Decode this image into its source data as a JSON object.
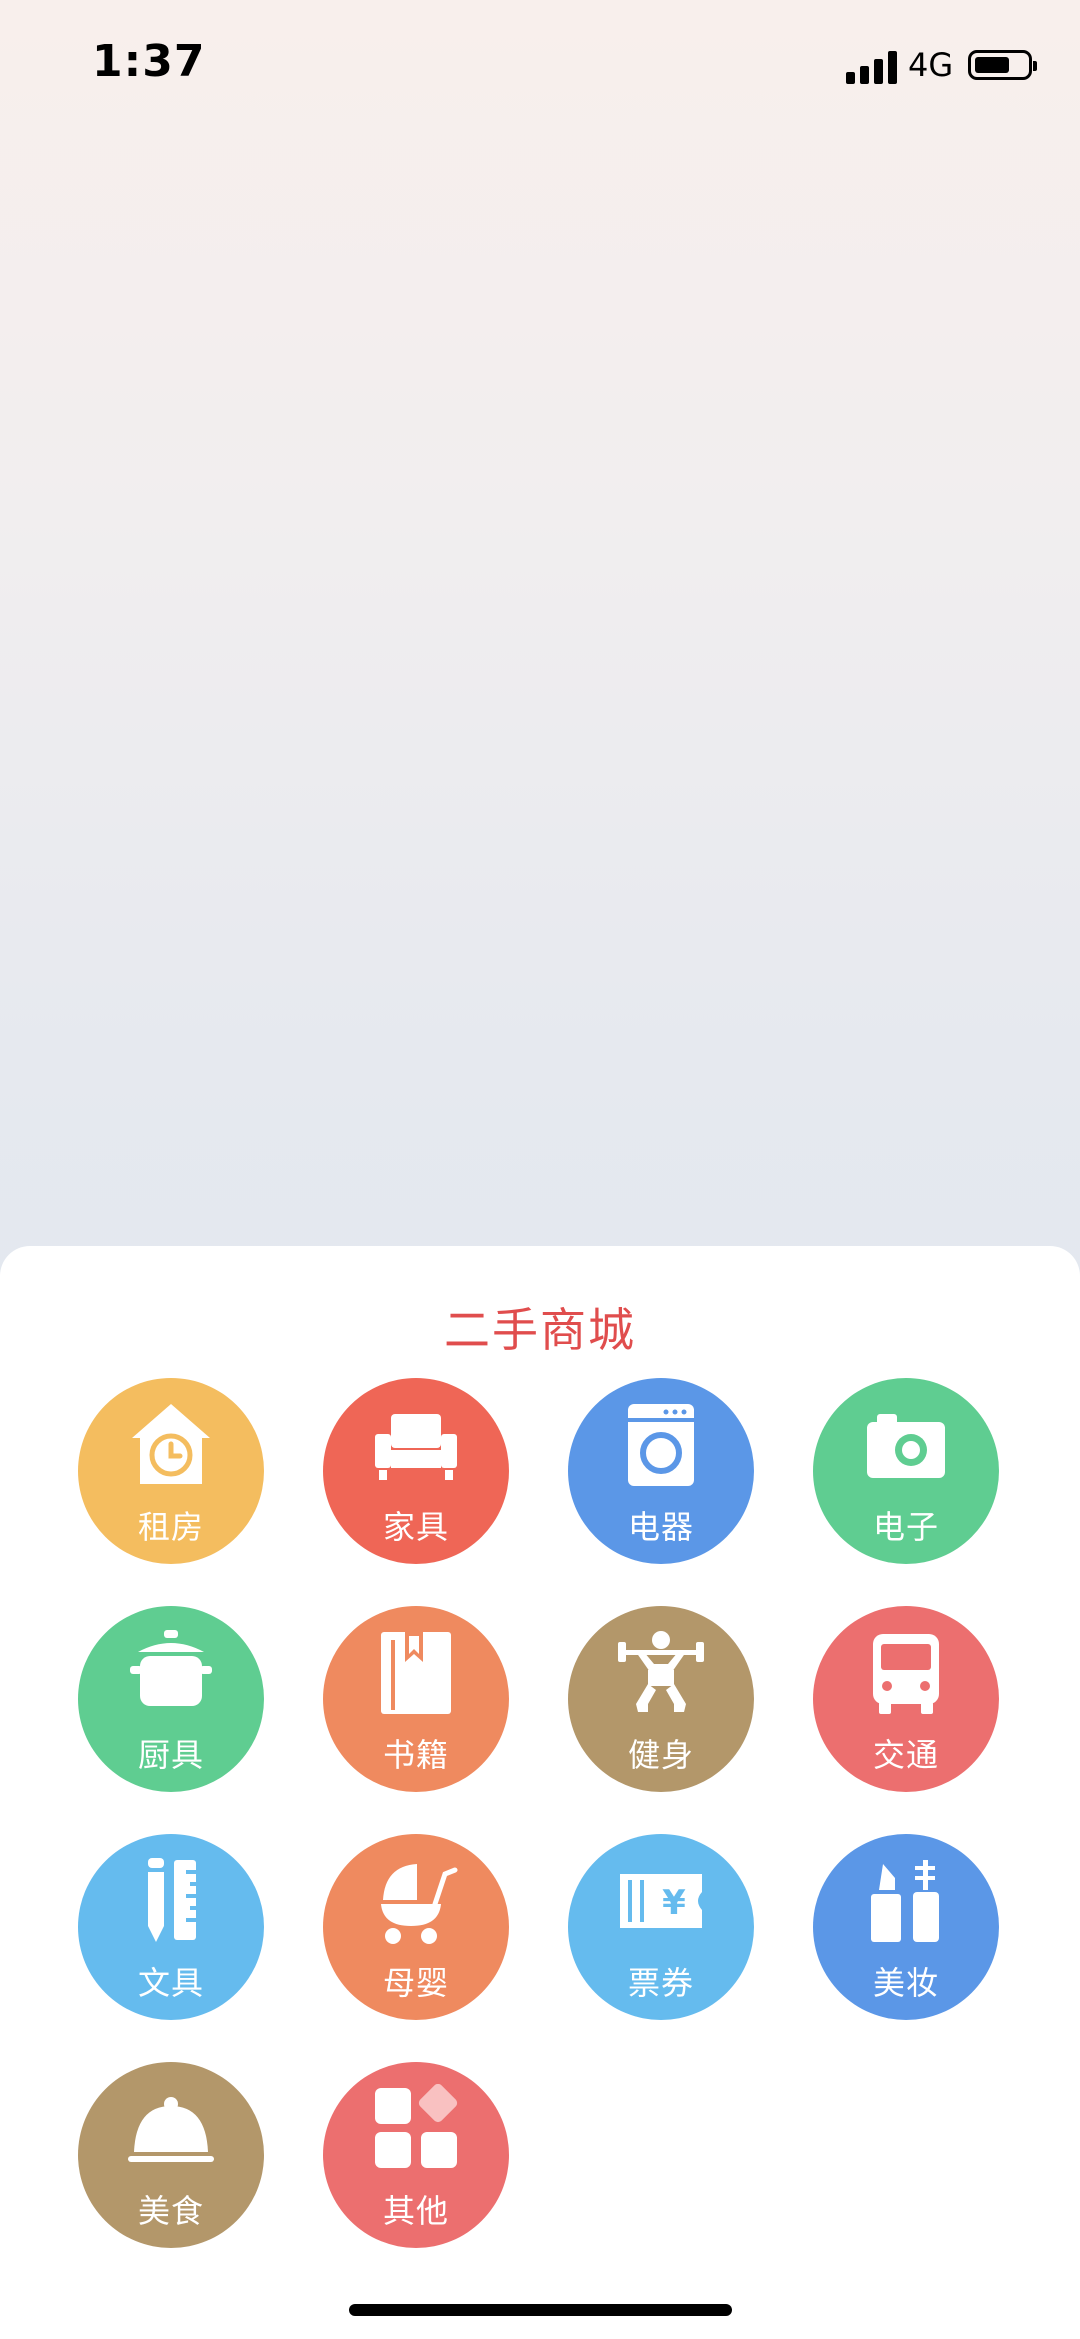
{
  "status_bar": {
    "time": "1:37",
    "network": "4G"
  },
  "sheet": {
    "title": "二手商城"
  },
  "categories": [
    {
      "label": "租房",
      "icon": "house-clock-icon",
      "color": "#f4bd5f"
    },
    {
      "label": "家具",
      "icon": "sofa-icon",
      "color": "#ef6656"
    },
    {
      "label": "电器",
      "icon": "washing-machine-icon",
      "color": "#5b97e7"
    },
    {
      "label": "电子",
      "icon": "camera-icon",
      "color": "#5fcd91"
    },
    {
      "label": "厨具",
      "icon": "cooking-pot-icon",
      "color": "#5fcd91"
    },
    {
      "label": "书籍",
      "icon": "book-icon",
      "color": "#ef8a5f"
    },
    {
      "label": "健身",
      "icon": "weightlifting-icon",
      "color": "#b3976a"
    },
    {
      "label": "交通",
      "icon": "bus-icon",
      "color": "#ec6f6f"
    },
    {
      "label": "文具",
      "icon": "pencil-ruler-icon",
      "color": "#65bbee"
    },
    {
      "label": "母婴",
      "icon": "baby-stroller-icon",
      "color": "#ef8a5f"
    },
    {
      "label": "票券",
      "icon": "ticket-icon",
      "color": "#65bbee"
    },
    {
      "label": "美妆",
      "icon": "cosmetics-icon",
      "color": "#5b97e7"
    },
    {
      "label": "美食",
      "icon": "food-cloche-icon",
      "color": "#b3976a"
    },
    {
      "label": "其他",
      "icon": "grid-apps-icon",
      "color": "#ec6f6f"
    }
  ]
}
